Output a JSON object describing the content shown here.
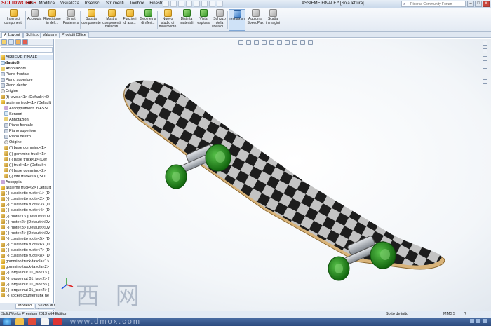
{
  "app": {
    "logo": "SOLIDWORKS",
    "window_title": "ASSIEME FINALE * [Sola lettura]",
    "search_placeholder": "Ricerca Community Forum"
  },
  "menu": [
    "File",
    "Modifica",
    "Visualizza",
    "Inserisci",
    "Strumenti",
    "Toolbox",
    "Finestra"
  ],
  "ribbon": [
    {
      "label": "Inserisci\ncomponenti",
      "icon": "insert-components-icon",
      "color": "yellow"
    },
    {
      "label": "Accoppia",
      "icon": "mate-icon",
      "color": "gray"
    },
    {
      "label": "Ripetizione\nlin del ...",
      "icon": "linear-pattern-icon",
      "color": "yellow"
    },
    {
      "label": "Smart\nFasteners",
      "icon": "smart-fasteners-icon",
      "color": "gray"
    },
    {
      "label": "Sposta\ncomponente",
      "icon": "move-component-icon",
      "color": "yellow"
    },
    {
      "label": "Mostra\ncomponenti\nnascosti",
      "icon": "show-hidden-icon",
      "color": "yellow"
    },
    {
      "label": "Funzioni\ndi ass...",
      "icon": "assembly-features-icon",
      "color": "yellow"
    },
    {
      "label": "Geometria\ndi riferi...",
      "icon": "reference-geometry-icon",
      "color": "green"
    },
    {
      "label": "Nuovo\nstudio di\nmovimento",
      "icon": "motion-study-icon",
      "color": "yellow"
    },
    {
      "label": "Distinta\nmateriali",
      "icon": "bom-icon",
      "color": "green"
    },
    {
      "label": "Vista\nesplosa",
      "icon": "exploded-view-icon",
      "color": "green"
    },
    {
      "label": "Schizzo\ndella\nlinea di ...",
      "icon": "explode-line-icon",
      "color": "gray"
    },
    {
      "label": "Instant3D",
      "icon": "instant3d-icon",
      "color": "blue"
    },
    {
      "label": "Aggiorna\nSpeedPak",
      "icon": "speedpak-icon",
      "color": "gray"
    },
    {
      "label": "Scatta\nimmagini",
      "icon": "snapshot-icon",
      "color": "gray"
    }
  ],
  "command_tabs": [
    "Assieme",
    "Layout",
    "Schizzo",
    "Valutare",
    "Prodotti Office"
  ],
  "tree": {
    "root": "ASSIEME FINALE (Default<Di",
    "items": [
      {
        "label": "Sensori",
        "type": "sensor",
        "indent": 0
      },
      {
        "label": "Annotazioni",
        "type": "folder",
        "indent": 0
      },
      {
        "label": "Piano frontale",
        "type": "plane",
        "indent": 0
      },
      {
        "label": "Piano superiore",
        "type": "plane",
        "indent": 0
      },
      {
        "label": "Piano destro",
        "type": "plane",
        "indent": 0
      },
      {
        "label": "Origine",
        "type": "origin",
        "indent": 0
      },
      {
        "label": "(f) tavola<1> (Default<<D",
        "type": "part",
        "indent": 0
      },
      {
        "label": "assieme truck<1> (Default",
        "type": "asm",
        "indent": 0
      },
      {
        "label": "Accoppiamenti in ASSI",
        "type": "mate",
        "indent": 1
      },
      {
        "label": "Sensori",
        "type": "sensor",
        "indent": 1
      },
      {
        "label": "Annotazioni",
        "type": "folder",
        "indent": 1
      },
      {
        "label": "Piano frontale",
        "type": "plane",
        "indent": 1
      },
      {
        "label": "Piano superiore",
        "type": "plane",
        "indent": 1
      },
      {
        "label": "Piano destro",
        "type": "plane",
        "indent": 1
      },
      {
        "label": "Origine",
        "type": "origin",
        "indent": 1
      },
      {
        "label": "(f) base gommino<1>",
        "type": "part",
        "indent": 1
      },
      {
        "label": "(-) gommino truck<1>",
        "type": "part",
        "indent": 1
      },
      {
        "label": "(-) base truck<1> (Def",
        "type": "part",
        "indent": 1
      },
      {
        "label": "(-) truck<1> (Default<",
        "type": "part",
        "indent": 1
      },
      {
        "label": "(-) base gommino<2>",
        "type": "part",
        "indent": 1
      },
      {
        "label": "(-) vite truck<1> (ISO",
        "type": "part",
        "indent": 1
      },
      {
        "label": "Accoppia",
        "type": "mate",
        "indent": 0
      },
      {
        "label": "assieme truck<2> (Default",
        "type": "asm",
        "indent": 0
      },
      {
        "label": "(-) cuscinetto ruote<1> (D",
        "type": "part",
        "indent": 0
      },
      {
        "label": "(-) cuscinetto ruote<2> (D",
        "type": "part",
        "indent": 0
      },
      {
        "label": "(-) cuscinetto ruote<3> (D",
        "type": "part",
        "indent": 0
      },
      {
        "label": "(-) cuscinetto ruote<4> (D",
        "type": "part",
        "indent": 0
      },
      {
        "label": "(-) ruote<1> (Default<<Dv",
        "type": "part",
        "indent": 0
      },
      {
        "label": "(-) ruote<2> (Default<<Dv",
        "type": "part",
        "indent": 0
      },
      {
        "label": "(-) ruote<3> (Default<<Dv",
        "type": "part",
        "indent": 0
      },
      {
        "label": "(-) ruote<4> (Default<<Dv",
        "type": "part",
        "indent": 0
      },
      {
        "label": "(-) cuscinetto ruote<5> (D",
        "type": "part",
        "indent": 0
      },
      {
        "label": "(-) cuscinetto ruote<6> (D",
        "type": "part",
        "indent": 0
      },
      {
        "label": "(-) cuscinetto ruote<7> (D",
        "type": "part",
        "indent": 0
      },
      {
        "label": "(-) cuscinetto ruote<8> (D",
        "type": "part",
        "indent": 0
      },
      {
        "label": "gommino truck-tavola<1>",
        "type": "asm",
        "indent": 0
      },
      {
        "label": "gommino truck-tavola<2>",
        "type": "asm",
        "indent": 0
      },
      {
        "label": "(-) torque nut 01_iso<1> (",
        "type": "part",
        "indent": 0
      },
      {
        "label": "(-) torque nut 01_iso<2> (",
        "type": "part",
        "indent": 0
      },
      {
        "label": "(-) torque nut 01_iso<3> (",
        "type": "part",
        "indent": 0
      },
      {
        "label": "(-) torque nut 01_iso<4> (",
        "type": "part",
        "indent": 0
      },
      {
        "label": "(-) socket countersunk he",
        "type": "part",
        "indent": 0
      }
    ]
  },
  "panel_tabs": [
    "Modello",
    "Studio di movimento 1"
  ],
  "status": {
    "left": "SolidWorks Premium 2013 x64 Edition",
    "definition": "Sotto definito",
    "units": "MMGS",
    "help": "?"
  },
  "watermark": "西 网",
  "taskbar_watermark": "www.dmox.com",
  "colors": {
    "accent": "#3b7cc7",
    "wheel": "#1e8a1a",
    "deck_dark": "#222222",
    "deck_light": "#bdbdbd",
    "edge": "#d9b47a"
  }
}
